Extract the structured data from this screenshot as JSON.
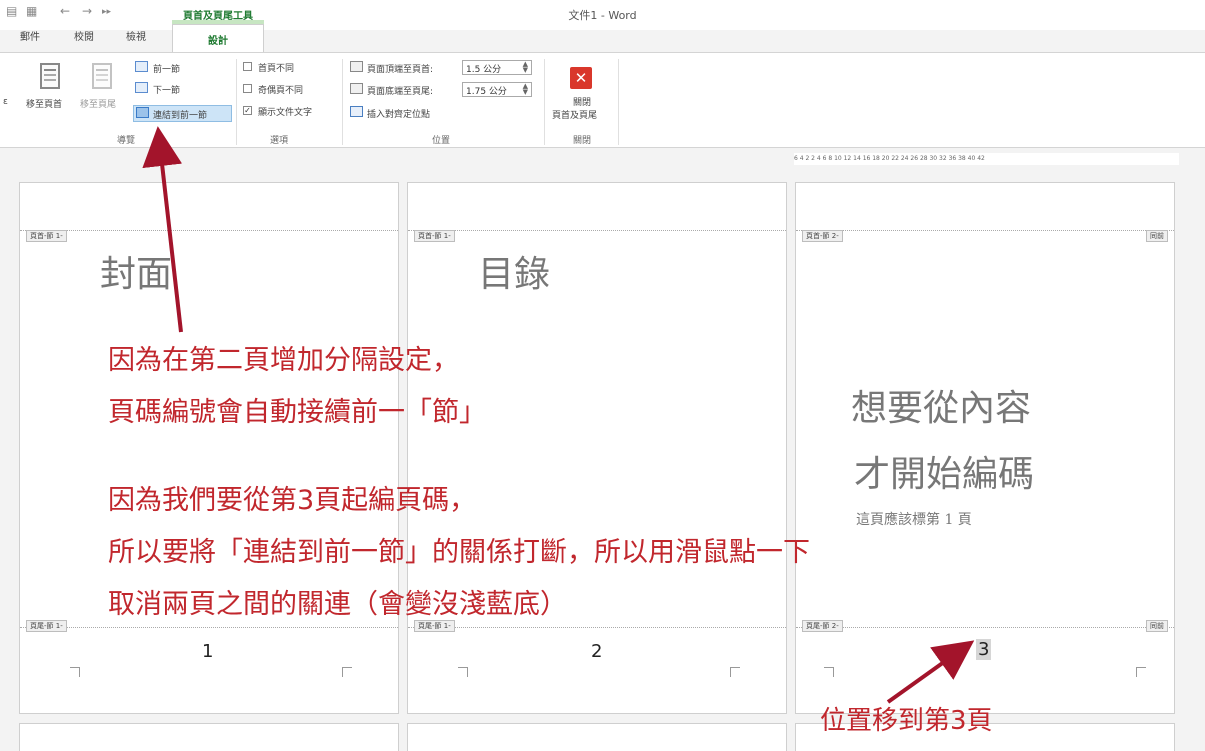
{
  "titlebar": {
    "window_title": "文件1 - Word",
    "context_tab_title": "頁首及頁尾工具",
    "qat": [
      "←",
      "→",
      "▸▸"
    ]
  },
  "tabs": [
    {
      "label": "郵件"
    },
    {
      "label": "校閱"
    },
    {
      "label": "檢視"
    }
  ],
  "active_tab": "設計",
  "ribbon": {
    "nav_group": {
      "goto_header": "移至頁首",
      "goto_footer": "移至頁尾",
      "previous": "前一節",
      "next": "下一節",
      "link_to_previous": "連結到前一節",
      "group_label": "導覽"
    },
    "options_group": {
      "first_page_diff": "首頁不同",
      "odd_even_diff": "奇偶頁不同",
      "show_doc_text": "顯示文件文字",
      "show_doc_text_checked": "✓",
      "group_label": "選項"
    },
    "position_group": {
      "header_top_label": "頁面頂端至頁首:",
      "header_top_value": "1.5 公分",
      "footer_bottom_label": "頁面底端至頁尾:",
      "footer_bottom_value": "1.75 公分",
      "insert_align_tab": "插入對齊定位點",
      "group_label": "位置"
    },
    "close_group": {
      "close_line1": "關閉",
      "close_line2": "頁首及頁尾",
      "group_label": "關閉"
    },
    "left_cut": "ε"
  },
  "ruler": {
    "text": "6  4  2     2  4  6  8  10 12 14 16 18 20 22 24 26 28 30 32    36 38 40 42"
  },
  "pages": [
    {
      "header_tag": "頁首-節 1-",
      "title": "封面",
      "footer_tag": "頁尾-節 1-",
      "page_number": "1"
    },
    {
      "header_tag": "頁首-節 1-",
      "title": "目錄",
      "footer_tag": "頁尾-節 1-",
      "page_number": "2"
    },
    {
      "header_tag": "頁首-節 2-",
      "same_as_prev": "同前",
      "title_line1": "想要從內容",
      "title_line2": "才開始編碼",
      "subtitle": "這頁應該標第 1 頁",
      "footer_tag": "頁尾-節 2-",
      "footer_same_as_prev": "同前",
      "page_number": "3"
    }
  ],
  "annotations": {
    "line1": "因為在第二頁增加分隔設定，",
    "line2": "頁碼編號會自動接續前一「節」",
    "line3": "因為我們要從第3頁起編頁碼，",
    "line4": "所以要將「連結到前一節」的關係打斷，所以用滑鼠點一下",
    "line5": "取消兩頁之間的關連（會變沒淺藍底）",
    "position_note": "位置移到第3頁"
  },
  "colors": {
    "annotation": "#c1272d",
    "contextual_tab": "#1f7a31",
    "highlight": "#cde4f7"
  }
}
